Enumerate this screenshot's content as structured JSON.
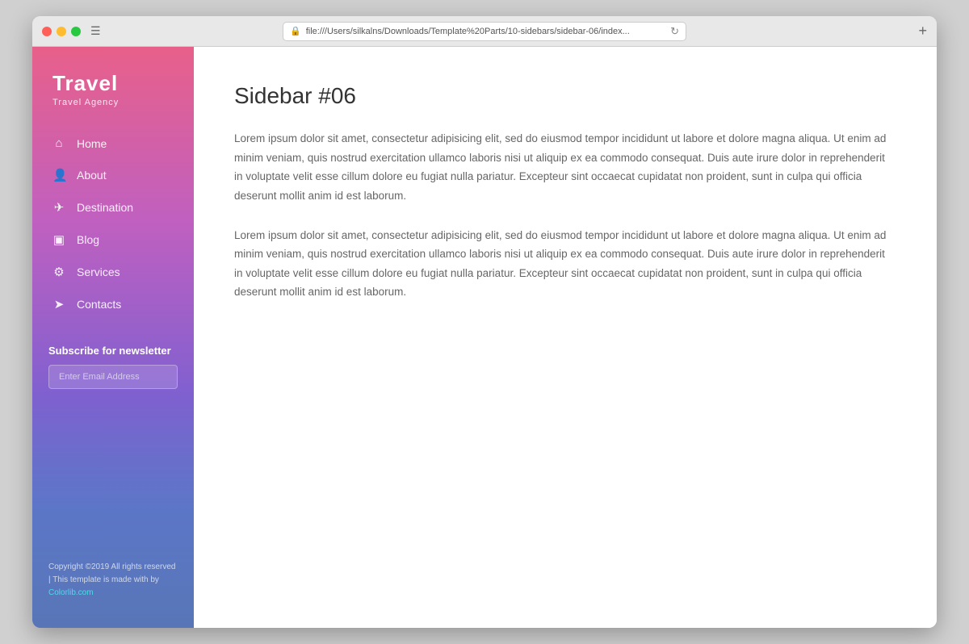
{
  "browser": {
    "url": "file:///Users/silkalns/Downloads/Template%20Parts/10-sidebars/sidebar-06/index...",
    "menu_icon": "☰",
    "refresh_icon": "↻",
    "add_tab_icon": "+"
  },
  "sidebar": {
    "brand": {
      "title": "Travel",
      "subtitle": "Travel Agency"
    },
    "nav_items": [
      {
        "icon": "⌂",
        "label": "Home",
        "icon_name": "home-icon"
      },
      {
        "icon": "👤",
        "label": "About",
        "icon_name": "user-icon"
      },
      {
        "icon": "✈",
        "label": "Destination",
        "icon_name": "plane-icon"
      },
      {
        "icon": "▣",
        "label": "Blog",
        "icon_name": "blog-icon"
      },
      {
        "icon": "⚙",
        "label": "Services",
        "icon_name": "gear-icon"
      },
      {
        "icon": "➤",
        "label": "Contacts",
        "icon_name": "contacts-icon"
      }
    ],
    "subscribe": {
      "label": "Subscribe for newsletter",
      "input_placeholder": "Enter Email Address"
    },
    "footer": {
      "text": "Copyright ©2019 All rights reserved | This template is made with by ",
      "link_text": "Colorlib.com",
      "link_url": "#"
    }
  },
  "main": {
    "title": "Sidebar #06",
    "paragraphs": [
      "Lorem ipsum dolor sit amet, consectetur adipisicing elit, sed do eiusmod tempor incididunt ut labore et dolore magna aliqua. Ut enim ad minim veniam, quis nostrud exercitation ullamco laboris nisi ut aliquip ex ea commodo consequat. Duis aute irure dolor in reprehenderit in voluptate velit esse cillum dolore eu fugiat nulla pariatur. Excepteur sint occaecat cupidatat non proident, sunt in culpa qui officia deserunt mollit anim id est laborum.",
      "Lorem ipsum dolor sit amet, consectetur adipisicing elit, sed do eiusmod tempor incididunt ut labore et dolore magna aliqua. Ut enim ad minim veniam, quis nostrud exercitation ullamco laboris nisi ut aliquip ex ea commodo consequat. Duis aute irure dolor in reprehenderit in voluptate velit esse cillum dolore eu fugiat nulla pariatur. Excepteur sint occaecat cupidatat non proident, sunt in culpa qui officia deserunt mollit anim id est laborum."
    ]
  }
}
